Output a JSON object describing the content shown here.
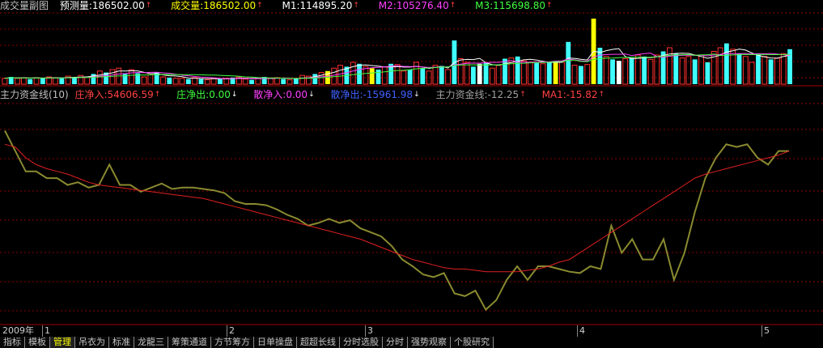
{
  "volume_header": {
    "title": "成交量副图",
    "forecast": "预测量:186502.00",
    "volume": "成交量:186502.00",
    "m1": "M1:114895.20",
    "m2": "M2:105276.40",
    "m3": "M3:115698.80"
  },
  "fund_header": {
    "title": "主力资金线(10)",
    "zhuang_in": "庄净入:54606.59",
    "zhuang_out": "庄净出:0.00",
    "san_in": "散净入:0.00",
    "san_out": "散净出:-15961.98",
    "fund_line": "主力资金线:-12.25",
    "ma1": "MA1:-15.82"
  },
  "xaxis": {
    "year_label": "2009年",
    "ticks": [
      "1",
      "2",
      "3",
      "4",
      "5"
    ]
  },
  "tabs": [
    "指标",
    "模板",
    "管理",
    "吊衣为",
    "标准",
    "龙龍三",
    "筹策通道",
    "方节筹方",
    "日单操盘",
    "超超长线",
    "分时选股",
    "分时",
    "强势观察",
    "个股研究"
  ],
  "active_tab_index": 2,
  "colors": {
    "background": "#000000",
    "up_bar": "#ff3030",
    "down_bar": "#40ffff",
    "highlight_bar": "#ffff00",
    "white_bar": "#ffffff",
    "fund_line": "#8a8a30",
    "ma_line": "#e02020",
    "grid": "#8b0000"
  },
  "chart_data": [
    {
      "type": "bar",
      "title": "成交量副图",
      "series": [
        {
          "name": "成交量",
          "values": [
            8,
            10,
            8,
            9,
            7,
            9,
            8,
            10,
            9,
            8,
            11,
            9,
            12,
            10,
            14,
            18,
            16,
            20,
            22,
            14,
            20,
            15,
            10,
            13,
            16,
            10,
            9,
            8,
            8,
            7,
            9,
            7,
            6,
            8,
            7,
            8,
            9,
            10,
            7,
            6,
            8,
            10,
            8,
            9,
            7,
            6,
            8,
            12,
            11,
            14,
            16,
            18,
            22,
            26,
            24,
            30,
            28,
            24,
            22,
            20,
            24,
            28,
            27,
            18,
            20,
            30,
            22,
            18,
            26,
            25,
            20,
            60,
            35,
            30,
            24,
            28,
            30,
            22,
            26,
            35,
            36,
            38,
            32,
            30,
            29,
            28,
            31,
            32,
            30,
            58,
            26,
            25,
            27,
            90,
            50,
            38,
            34,
            32,
            35,
            36,
            40,
            38,
            34,
            40,
            45,
            50,
            42,
            36,
            38,
            34,
            40,
            30,
            45,
            50,
            56,
            48,
            42,
            38,
            30,
            40,
            38,
            34,
            36,
            42,
            48
          ]
        }
      ],
      "labels": [
        "M1:114895.20",
        "M2:105276.40",
        "M3:115698.80"
      ]
    },
    {
      "type": "line",
      "title": "主力资金线(10)",
      "series": [
        {
          "name": "主力资金线",
          "values": [
            60,
            45,
            30,
            30,
            25,
            25,
            20,
            22,
            18,
            20,
            35,
            20,
            20,
            15,
            18,
            21,
            17,
            18,
            18,
            17,
            16,
            14,
            8,
            6,
            6,
            5,
            2,
            -2,
            -5,
            -10,
            -8,
            -5,
            -8,
            -6,
            -12,
            -15,
            -18,
            -25,
            -35,
            -40,
            -46,
            -48,
            -45,
            -60,
            -62,
            -58,
            -72,
            -65,
            -50,
            -40,
            -50,
            -40,
            -40,
            -42,
            -44,
            -45,
            -40,
            -42,
            -10,
            -30,
            -20,
            -35,
            -35,
            -20,
            -50,
            -30,
            0,
            25,
            40,
            50,
            48,
            50,
            40,
            35,
            45,
            45
          ]
        },
        {
          "name": "MA1",
          "values": [
            50,
            48,
            40,
            35,
            32,
            30,
            28,
            25,
            22,
            20,
            19,
            18,
            17,
            16,
            15,
            14,
            13,
            12,
            11,
            10,
            8,
            6,
            4,
            2,
            0,
            -2,
            -4,
            -6,
            -8,
            -10,
            -12,
            -14,
            -16,
            -18,
            -20,
            -23,
            -26,
            -29,
            -32,
            -35,
            -37,
            -39,
            -41,
            -42,
            -42,
            -43,
            -44,
            -44,
            -44,
            -44,
            -43,
            -42,
            -40,
            -37,
            -35,
            -30,
            -25,
            -20,
            -15,
            -10,
            -5,
            0,
            5,
            10,
            15,
            20,
            25,
            28,
            30,
            32,
            34,
            36,
            38,
            40,
            42,
            45
          ]
        }
      ]
    }
  ]
}
